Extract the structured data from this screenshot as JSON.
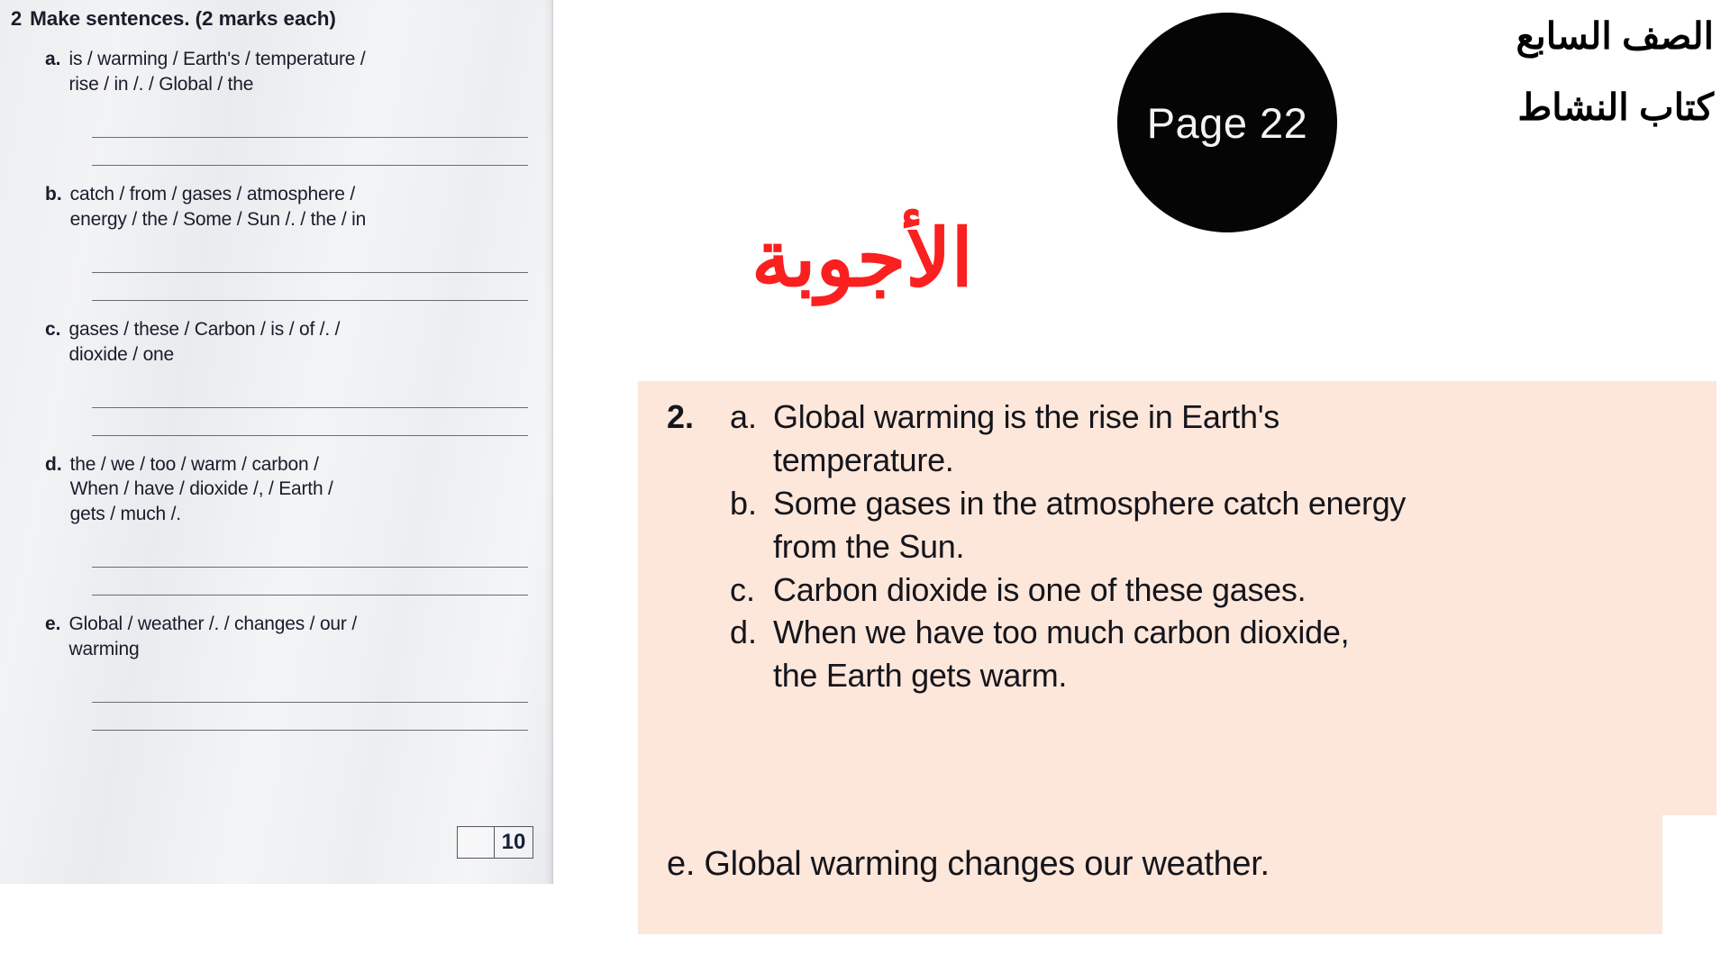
{
  "worksheet": {
    "task_number": "2",
    "task_title": "Make sentences. (2 marks each)",
    "items": [
      {
        "label": "a.",
        "text": "is / warming / Earth's / temperature /\nrise / in /. / Global / the"
      },
      {
        "label": "b.",
        "text": "catch / from / gases / atmosphere /\nenergy / the / Some / Sun /. / the / in"
      },
      {
        "label": "c.",
        "text": "gases / these / Carbon / is / of /. /\ndioxide / one"
      },
      {
        "label": "d.",
        "text": "the / we / too / warm / carbon /\nWhen / have / dioxide /, / Earth /\ngets / much /."
      },
      {
        "label": "e.",
        "text": "Global / weather /. / changes / our /\nwarming"
      }
    ],
    "marks_box": {
      "blank_cell": "",
      "total": "10"
    }
  },
  "page_badge": {
    "label": "Page 22"
  },
  "arabic_header": {
    "line1": "الصف السابع",
    "line2": "كتاب النشاط"
  },
  "answers_title": "الأجوبة",
  "answers": {
    "question_number": "2.",
    "items": [
      {
        "label": "a.",
        "text": "Global warming is the rise in Earth's\ntemperature."
      },
      {
        "label": "b.",
        "text": "Some gases in the atmosphere catch energy\nfrom the Sun."
      },
      {
        "label": "c.",
        "text": "Carbon dioxide is one of these gases."
      },
      {
        "label": "d.",
        "text": "When we have too much carbon dioxide,\nthe Earth gets warm."
      }
    ],
    "extra": "e. Global warming changes our weather."
  },
  "colors": {
    "title_red": "#fa2020",
    "panel_peach": "#fde7da",
    "badge_black": "#050505"
  }
}
